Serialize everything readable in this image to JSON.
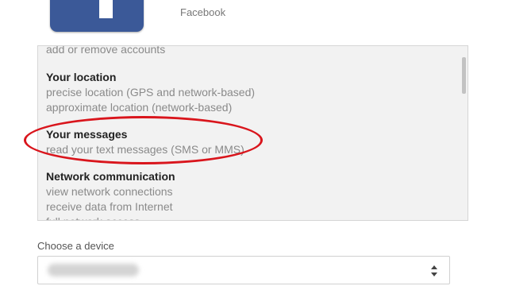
{
  "app": {
    "name": "Facebook",
    "icon": "facebook-icon",
    "brand_color": "#3b5998"
  },
  "permissions": [
    {
      "heading": "",
      "items": [
        "add or remove accounts"
      ]
    },
    {
      "heading": "Your location",
      "items": [
        "precise location (GPS and network-based)",
        "approximate location (network-based)"
      ]
    },
    {
      "heading": "Your messages",
      "items": [
        "read your text messages (SMS or MMS)"
      ],
      "highlighted": true,
      "highlight_color": "#d9151c"
    },
    {
      "heading": "Network communication",
      "items": [
        "view network connections",
        "receive data from Internet",
        "full network access"
      ]
    }
  ],
  "device": {
    "label": "Choose a device",
    "selected_value_blurred": true
  }
}
